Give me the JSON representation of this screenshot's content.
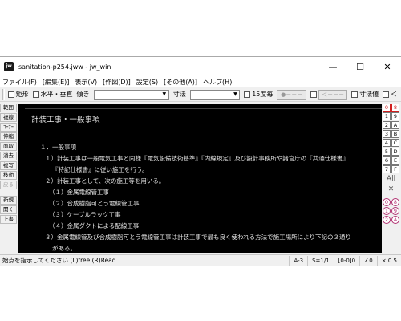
{
  "window": {
    "title": "sanitation-p254.jww - jw_win",
    "app_icon": "jw",
    "controls": {
      "minimize": "—",
      "maximize": "☐",
      "close": "✕"
    }
  },
  "menu": [
    "ファイル(F)",
    "[編集(E)]",
    "表示(V)",
    "[作図(D)]",
    "設定(S)",
    "[その他(A)]",
    "ヘルプ(H)"
  ],
  "toolbar": {
    "rect_label": "矩形",
    "hv_label": "水平・垂直",
    "tilt_label": "傾き",
    "dim_label": "寸法",
    "deg15_label": "15度毎",
    "btn1_label": "●－－－",
    "btn2_label": "＜－－－",
    "dim_value_label": "寸法値",
    "lt_label": "＜"
  },
  "left_tools": [
    {
      "label": "範囲",
      "disabled": false
    },
    {
      "label": "複線",
      "disabled": false
    },
    {
      "label": "ｺｰﾅｰ",
      "disabled": false
    },
    {
      "label": "伸縮",
      "disabled": false
    },
    {
      "label": "面取",
      "disabled": false
    },
    {
      "label": "消去",
      "disabled": false
    },
    {
      "label": "複写",
      "disabled": false
    },
    {
      "label": "移動",
      "disabled": false
    },
    {
      "label": "戻る",
      "disabled": true
    },
    {
      "label": "新規",
      "disabled": false
    },
    {
      "label": "開く",
      "disabled": false
    },
    {
      "label": "上書",
      "disabled": false
    }
  ],
  "canvas": {
    "heading": "計装工事・一般事項",
    "lines": [
      "１．一般事項",
      "１）計装工事は一般電気工事と同様『電気設備技術基準』『内線規定』及び設計事務所や諸官庁の『共通仕様書』",
      "『特記仕様書』に従い施工を行う。",
      "２）計装工事として、次の施工等を用いる。",
      "（１）金属電線管工事",
      "（２）合成樹脂可とう電線管工事",
      "（３）ケーブルラック工事",
      "（４）金属ダクトによる配線工事",
      "３）金属電線管及び合成樹脂可とう電線管工事は計装工事で最も良く使われる方法で施工場所により下記の３通り",
      "がある。"
    ]
  },
  "layers": {
    "rows": [
      [
        "0",
        "8"
      ],
      [
        "1",
        "9"
      ],
      [
        "2",
        "A"
      ],
      [
        "3",
        "B"
      ],
      [
        "4",
        "C"
      ],
      [
        "5",
        "D"
      ],
      [
        "6",
        "E"
      ],
      [
        "7",
        "F"
      ]
    ],
    "all_label": "All",
    "x_label": "✕",
    "group_rows": [
      [
        "0",
        "8"
      ],
      [
        "1",
        "9"
      ],
      [
        "2",
        "A"
      ]
    ]
  },
  "status": {
    "message": "始点を指示してください (L)free (R)Read",
    "paper": "A-3",
    "scale": "S=1/1",
    "layer": "[0-0]0",
    "angle": "∠0",
    "zoom": "× 0.5"
  },
  "colors": {
    "canvas_bg": "#000000",
    "active_layer": "#d02020",
    "group_layer": "#b03070"
  }
}
